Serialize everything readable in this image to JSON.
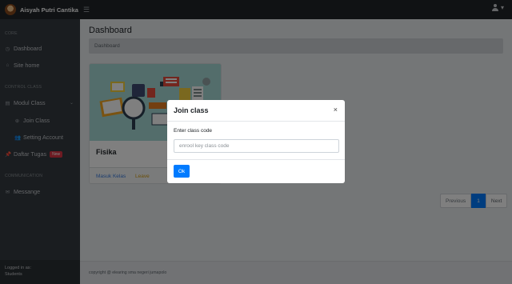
{
  "topbar": {
    "user_name": "Aisyah Putri Cantika",
    "menu_toggle_icon": "hamburger-icon",
    "user_menu_icon": "user-icon",
    "user_menu_caret": "caret-down-icon"
  },
  "sidebar": {
    "heading_core": "CORE",
    "heading_control": "CONTROL CLASS",
    "heading_comm": "COMMUNICATION",
    "items": [
      {
        "label": "Dashboard",
        "icon": "dashboard-icon"
      },
      {
        "label": "Site home",
        "icon": "home-icon"
      },
      {
        "label": "Modul Class",
        "icon": "book-icon"
      },
      {
        "label": "Join Class",
        "icon": "plus-circle-icon"
      },
      {
        "label": "Setting Account",
        "icon": "users-icon"
      },
      {
        "label": "Daftar Tugas",
        "icon": "pin-icon",
        "badge": "New"
      },
      {
        "label": "Messange",
        "icon": "chat-icon"
      }
    ],
    "footer_line1": "Logged in as:",
    "footer_line2": "Students"
  },
  "main": {
    "page_title": "Dashboard",
    "breadcrumb": "Dashboard",
    "course": {
      "name": "Fisika",
      "enter_link": "Masuk Kelas",
      "leave_link": "Leave"
    },
    "pagination": {
      "previous": "Previous",
      "current": "1",
      "next": "Next"
    },
    "footer_text": "copyright @ elearing sma negeri jumapolo"
  },
  "modal": {
    "title": "Join class",
    "close": "×",
    "field_label": "Enter class code",
    "field_placeholder": "enrool key class code",
    "field_value": "",
    "submit_label": "Ok"
  },
  "colors": {
    "sidebar_bg": "#343a40",
    "topbar_bg": "#212529",
    "primary": "#007bff",
    "badge_red": "#dc3545",
    "leave_yellow": "#d4a017"
  }
}
